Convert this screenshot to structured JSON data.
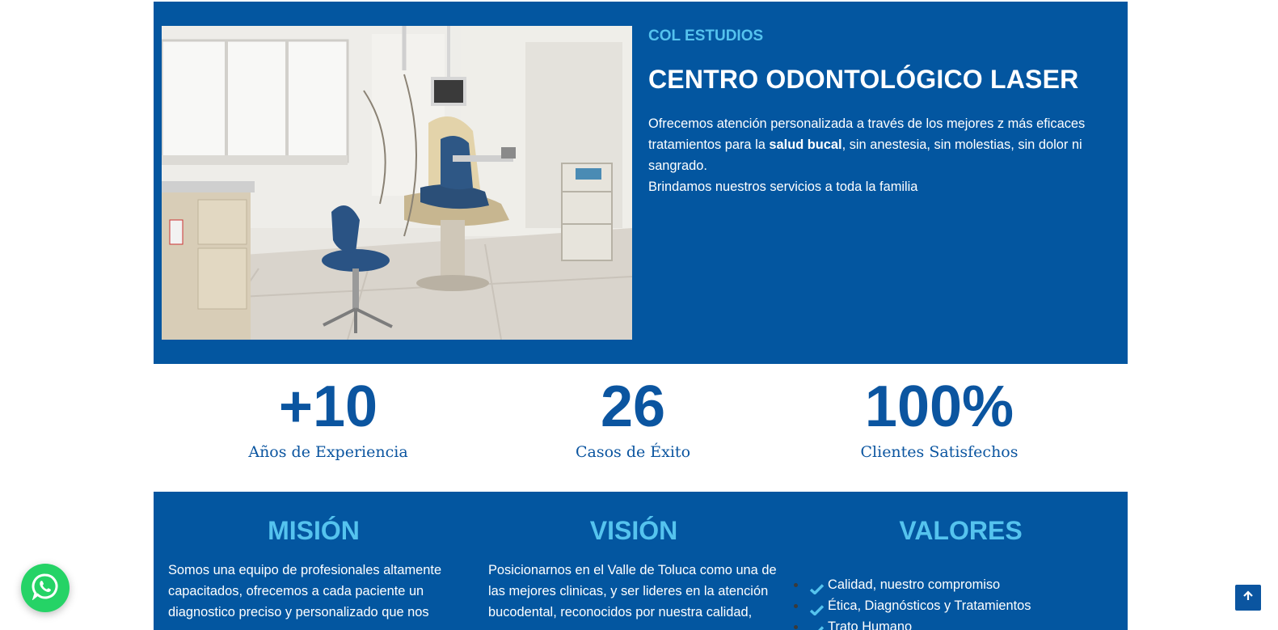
{
  "hero": {
    "eyebrow": "COL ESTUDIOS",
    "title": "CENTRO ODONTOLÓGICO LASER",
    "body_before": "Ofrecemos atención personalizada a través de los mejores z más eficaces tratamientos para la ",
    "body_bold": "salud bucal",
    "body_after": ", sin anestesia, sin molestias, sin dolor ni sangrado.",
    "body_line2": "Brindamos nuestros servicios a toda la familia"
  },
  "stats": [
    {
      "value": "+10",
      "label": "Años de Experiencia"
    },
    {
      "value": "26",
      "label": "Casos de Éxito"
    },
    {
      "value": "100%",
      "label": "Clientes Satisfechos"
    }
  ],
  "mision": {
    "title": "MISIÓN",
    "text": "Somos una equipo de profesionales altamente capacitados, ofrecemos a cada paciente un diagnostico preciso y personalizado que nos"
  },
  "vision": {
    "title": "VISIÓN",
    "text": "Posicionarnos en el Valle de Toluca como una de las mejores clinicas, y ser lideres en la atención bucodental, reconocidos por nuestra calidad,"
  },
  "valores": {
    "title": "VALORES",
    "items": [
      "Calidad, nuestro compromiso",
      "Ética, Diagnósticos y Tratamientos",
      "Trato Humano"
    ]
  },
  "icons": {
    "whatsapp": "whatsapp-icon",
    "scroll_top": "arrow-up-icon",
    "check": "check-icon"
  },
  "colors": {
    "brand_blue": "#0356a0",
    "accent_cyan": "#55c3ee",
    "whatsapp_green": "#25d366"
  }
}
